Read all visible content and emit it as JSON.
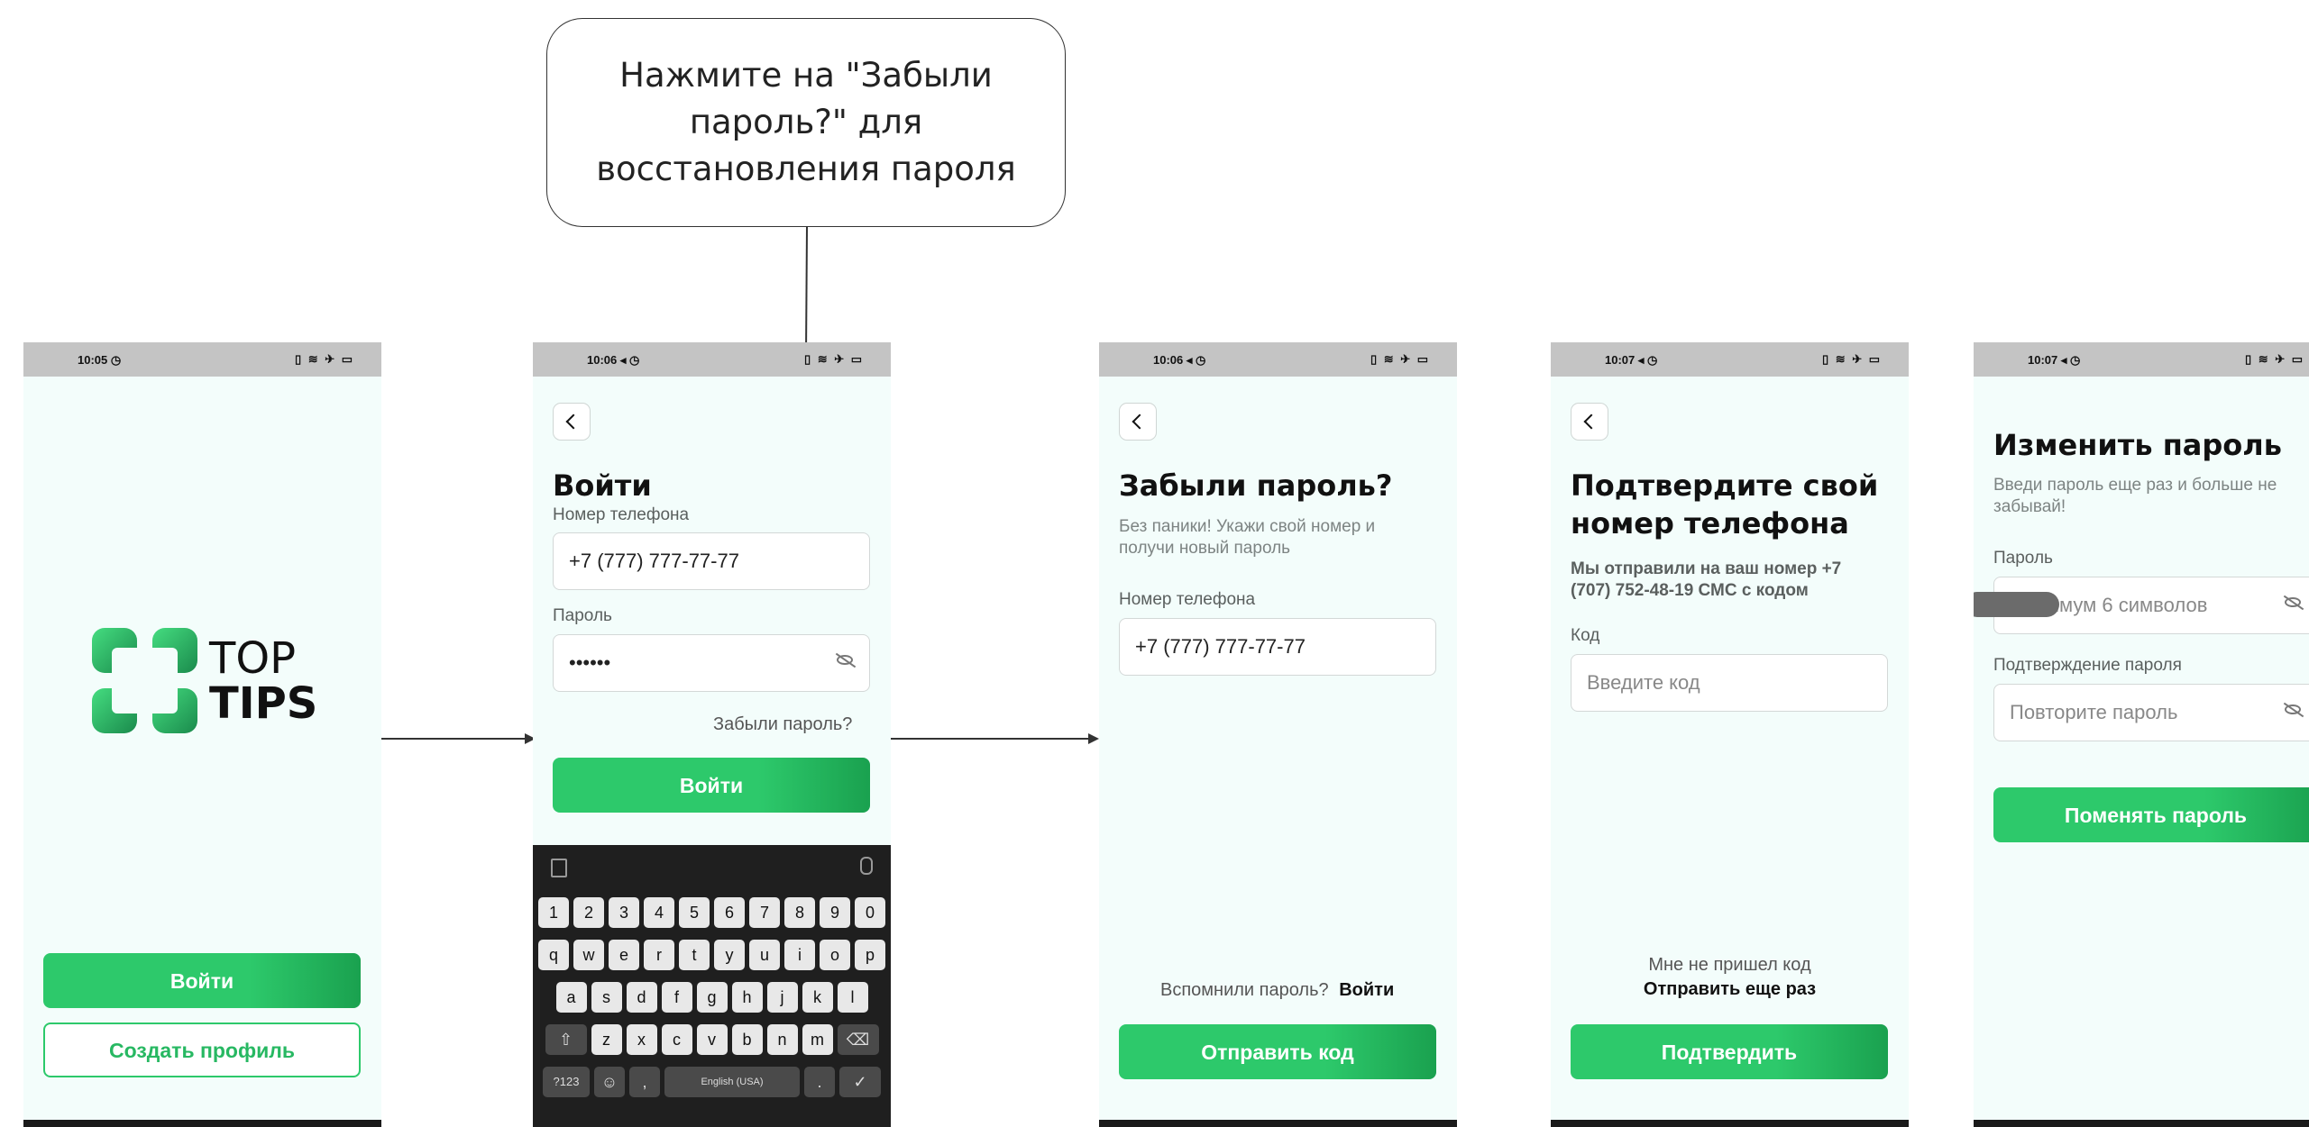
{
  "callout": {
    "text": "Нажмите на \"Забыли пароль?\" для восстановления пароля"
  },
  "screens": {
    "welcome": {
      "time": "10:05 ◷",
      "status_icons": "▯ ≋ ✈ ▭",
      "logo_line1": "TOP",
      "logo_line2": "TIPS",
      "login_button": "Войти",
      "create_profile_button": "Создать профиль"
    },
    "login": {
      "time": "10:06 ◂ ◷",
      "status_icons": "▯ ≋ ✈ ▭",
      "title": "Войти",
      "phone_label": "Номер телефона",
      "phone_value": "+7 (777) 777-77-77",
      "password_label": "Пароль",
      "password_value": "••••••",
      "forgot_link": "Забыли пароль?",
      "login_button": "Войти",
      "keyboard": {
        "numbers": [
          "1",
          "2",
          "3",
          "4",
          "5",
          "6",
          "7",
          "8",
          "9",
          "0"
        ],
        "row1": [
          "q",
          "w",
          "e",
          "r",
          "t",
          "y",
          "u",
          "i",
          "o",
          "p"
        ],
        "row2": [
          "a",
          "s",
          "d",
          "f",
          "g",
          "h",
          "j",
          "k",
          "l"
        ],
        "row3": [
          "z",
          "x",
          "c",
          "v",
          "b",
          "n",
          "m"
        ],
        "symbols_key": "?123",
        "space_label": "English (USA)"
      }
    },
    "forgot": {
      "time": "10:06 ◂ ◷",
      "status_icons": "▯ ≋ ✈ ▭",
      "title": "Забыли пароль?",
      "subtitle": "Без паники! Укажи свой номер и получи новый пароль",
      "phone_label": "Номер телефона",
      "phone_value": "+7 (777) 777-77-77",
      "remembered_text": "Вспомнили пароль?",
      "remembered_link": "Войти",
      "send_button": "Отправить код"
    },
    "confirm": {
      "time": "10:07 ◂ ◷",
      "status_icons": "▯ ≋ ✈ ▭",
      "title": "Подтвердите свой номер телефона",
      "subtitle": "Мы отправили на ваш номер +7 (707) 752-48-19 СМС с кодом",
      "code_label": "Код",
      "code_placeholder": "Введите код",
      "no_code_text": "Мне не пришел код",
      "resend_link": "Отправить еще раз",
      "confirm_button": "Подтвердить"
    },
    "change": {
      "time": "10:07 ◂ ◷",
      "status_icons": "▯ ≋ ✈ ▭",
      "title": "Изменить пароль",
      "subtitle": "Введи пароль еще раз и больше не забывай!",
      "password_label": "Пароль",
      "password_placeholder": "Минимум 6 символов",
      "confirm_label": "Подтверждение пароля",
      "confirm_placeholder": "Повторите пароль",
      "change_button": "Поменять пароль"
    }
  }
}
